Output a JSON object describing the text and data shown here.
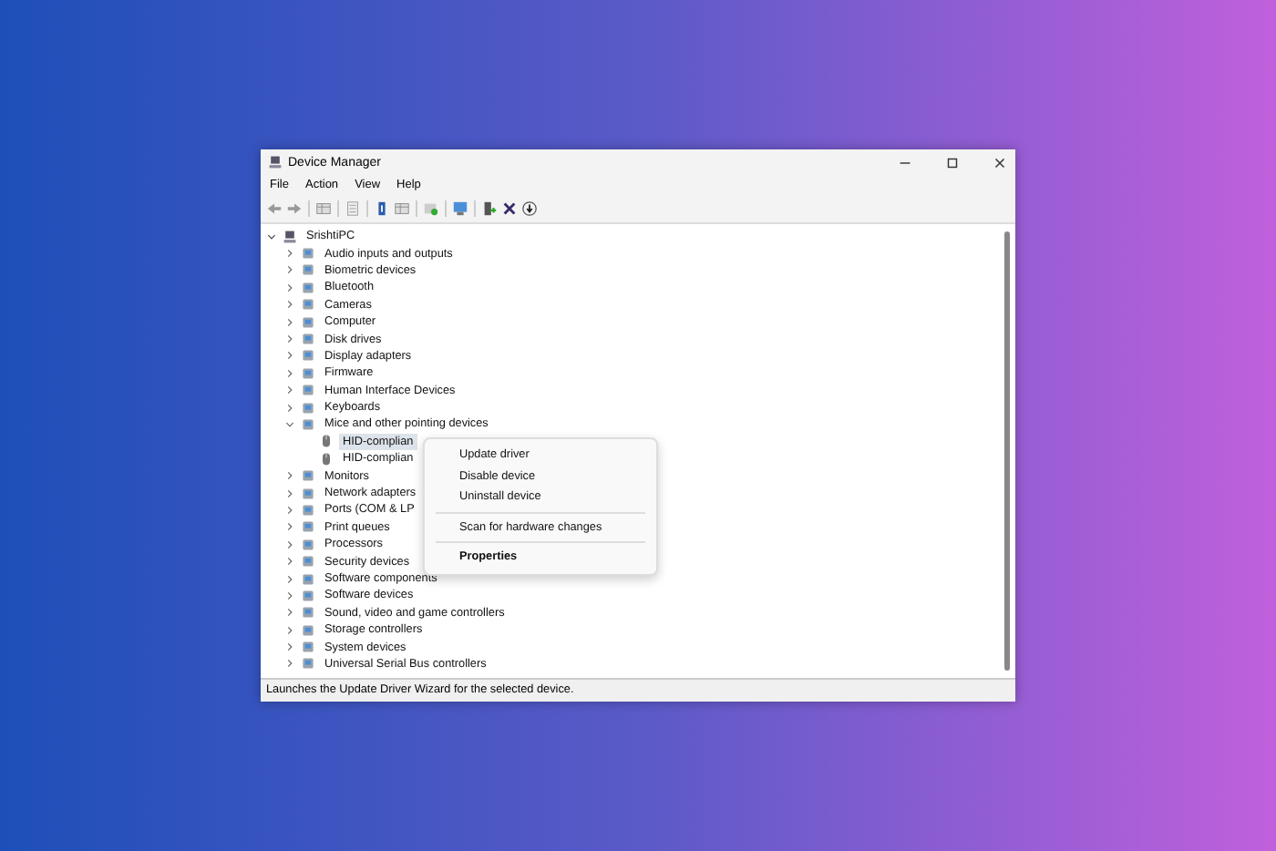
{
  "window": {
    "title": "Device Manager"
  },
  "menu": [
    "File",
    "Action",
    "View",
    "Help"
  ],
  "tree": {
    "label": "SrishtiPC",
    "expanded": true,
    "selected": false,
    "children": [
      {
        "label": "Audio inputs and outputs",
        "expanded": false,
        "selected": false
      },
      {
        "label": "Biometric devices",
        "expanded": false,
        "selected": false
      },
      {
        "label": "Bluetooth",
        "expanded": false,
        "selected": false
      },
      {
        "label": "Cameras",
        "expanded": false,
        "selected": false
      },
      {
        "label": "Computer",
        "expanded": false,
        "selected": false
      },
      {
        "label": "Disk drives",
        "expanded": false,
        "selected": false
      },
      {
        "label": "Display adapters",
        "expanded": false,
        "selected": false
      },
      {
        "label": "Firmware",
        "expanded": false,
        "selected": false
      },
      {
        "label": "Human Interface Devices",
        "expanded": false,
        "selected": false
      },
      {
        "label": "Keyboards",
        "expanded": false,
        "selected": false
      },
      {
        "label": "Mice and other pointing devices",
        "expanded": true,
        "selected": false,
        "children": [
          {
            "label": "HID-complian",
            "selected": true
          },
          {
            "label": "HID-complian",
            "selected": false
          }
        ]
      },
      {
        "label": "Monitors",
        "expanded": false,
        "selected": false
      },
      {
        "label": "Network adapters",
        "expanded": false,
        "selected": false
      },
      {
        "label": "Ports (COM & LP",
        "expanded": false,
        "selected": false
      },
      {
        "label": "Print queues",
        "expanded": false,
        "selected": false
      },
      {
        "label": "Processors",
        "expanded": false,
        "selected": false
      },
      {
        "label": "Security devices",
        "expanded": false,
        "selected": false
      },
      {
        "label": "Software components",
        "expanded": false,
        "selected": false
      },
      {
        "label": "Software devices",
        "expanded": false,
        "selected": false
      },
      {
        "label": "Sound, video and game controllers",
        "expanded": false,
        "selected": false
      },
      {
        "label": "Storage controllers",
        "expanded": false,
        "selected": false
      },
      {
        "label": "System devices",
        "expanded": false,
        "selected": false
      },
      {
        "label": "Universal Serial Bus controllers",
        "expanded": false,
        "selected": false
      }
    ]
  },
  "context_menu": [
    {
      "label": "Update driver",
      "separator_before": false,
      "default": false
    },
    {
      "label": "Disable device",
      "separator_before": false,
      "default": false
    },
    {
      "label": "Uninstall device",
      "separator_before": false,
      "default": false
    },
    {
      "label": "Scan for hardware changes",
      "separator_before": true,
      "default": false
    },
    {
      "label": "Properties",
      "separator_before": true,
      "default": true
    }
  ],
  "status_bar": "Launches the Update Driver Wizard for the selected device."
}
